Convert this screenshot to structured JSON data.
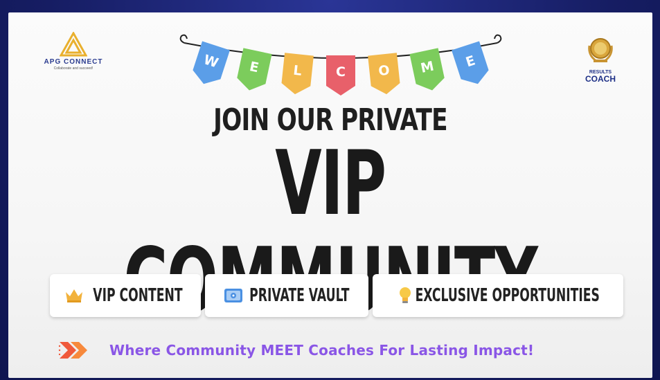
{
  "logos": {
    "left": {
      "name": "APG CONNECT",
      "tagline": "Collaborate and succeed!",
      "color": "#e9b02e",
      "text_color": "#2a3b8f"
    },
    "right": {
      "line1": "RESULTS",
      "line2": "COACH",
      "color": "#1d2f86"
    }
  },
  "banner": {
    "letters": [
      "W",
      "E",
      "L",
      "C",
      "O",
      "M",
      "E"
    ],
    "colors": [
      "#5b9ee8",
      "#7ccc5c",
      "#f2b84b",
      "#e8606a",
      "#f2b84b",
      "#7ccc5c",
      "#5b9ee8"
    ]
  },
  "headline": {
    "line1": "JOIN OUR PRIVATE",
    "line2": "VIP COMMUNITY"
  },
  "features": [
    {
      "label": "VIP CONTENT",
      "icon": "crown-icon"
    },
    {
      "label": "PRIVATE VAULT",
      "icon": "vault-icon"
    },
    {
      "label": "EXCLUSIVE OPPORTUNITIES",
      "icon": "lightbulb-icon"
    }
  ],
  "tagline": {
    "text": "Where Community MEET Coaches For Lasting Impact!",
    "icon": "double-chevron-right-icon",
    "color": "#8a56e6"
  }
}
